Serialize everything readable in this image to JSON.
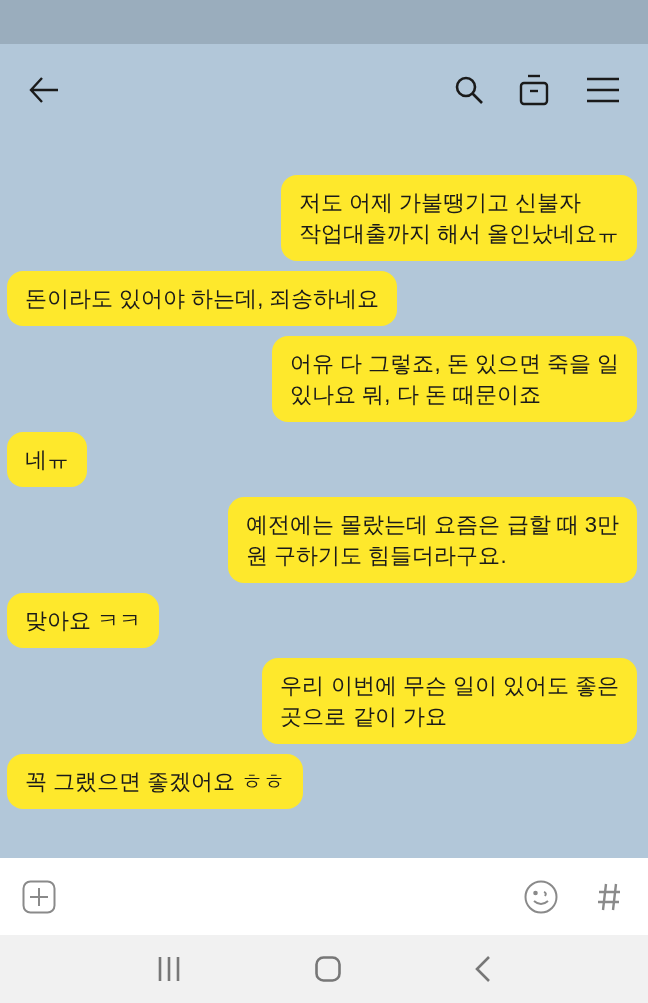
{
  "messages": [
    {
      "kind": "sent",
      "text": "저도 어제 가불땡기고 신불자\n작업대출까지 해서 올인났네요ㅠ"
    },
    {
      "kind": "received",
      "text": "돈이라도 있어야 하는데, 죄송하네요"
    },
    {
      "kind": "sent",
      "text": "어유 다 그렇죠, 돈 있으면 죽을 일\n있나요 뭐, 다 돈 때문이죠"
    },
    {
      "kind": "received",
      "text": "네ㅠ"
    },
    {
      "kind": "sent",
      "text": "예전에는 몰랐는데 요즘은 급할 때 3만\n원 구하기도 힘들더라구요."
    },
    {
      "kind": "received",
      "text": "맞아요 ㅋㅋ"
    },
    {
      "kind": "sent",
      "text": "우리 이번에 무슨 일이 있어도 좋은\n곳으로 같이 가요"
    },
    {
      "kind": "received",
      "text": "꼭 그랬으면 좋겠어요 ㅎㅎ"
    }
  ]
}
